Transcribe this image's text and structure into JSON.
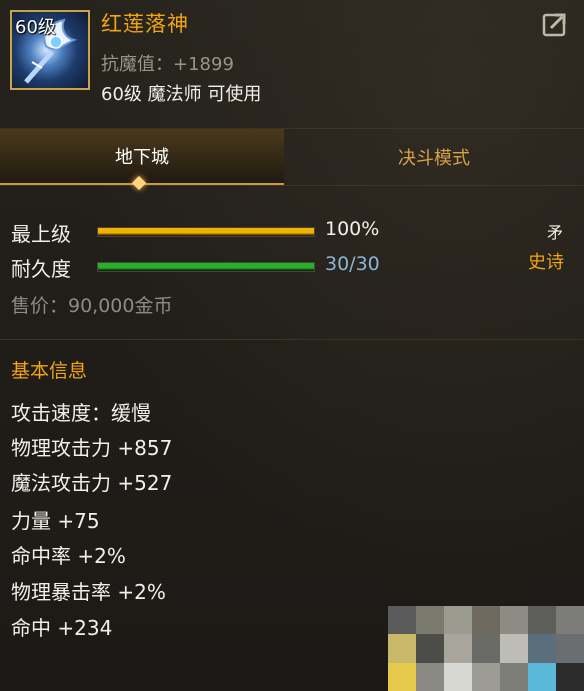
{
  "item": {
    "level_badge": "60级",
    "name": "红莲落神",
    "stat_line": "抗魔值：+1899",
    "requirement": "60级 魔法师 可使用"
  },
  "tabs": [
    {
      "label": "地下城",
      "active": true
    },
    {
      "label": "决斗模式",
      "active": false
    }
  ],
  "bars": [
    {
      "label": "最上级",
      "value_text": "100%",
      "fill": 1.0,
      "color": "#f0b400"
    },
    {
      "label": "耐久度",
      "value_text": "30/30",
      "fill": 1.0,
      "color": "#27b02a"
    }
  ],
  "grade": {
    "top": "矛",
    "bottom": "史诗"
  },
  "price": "售价：90,000金币",
  "section_title": "基本信息",
  "attributes": [
    "攻击速度：缓慢",
    "物理攻击力 +857",
    "魔法攻击力 +527",
    "力量 +75",
    "命中率 +2%",
    "物理暴击率 +2%",
    "命中 +234"
  ],
  "colors": {
    "accent": "#f3a50f",
    "durability_text": "#8db4d8"
  },
  "icons": {
    "share": "share-icon",
    "item": "staff-icon"
  }
}
